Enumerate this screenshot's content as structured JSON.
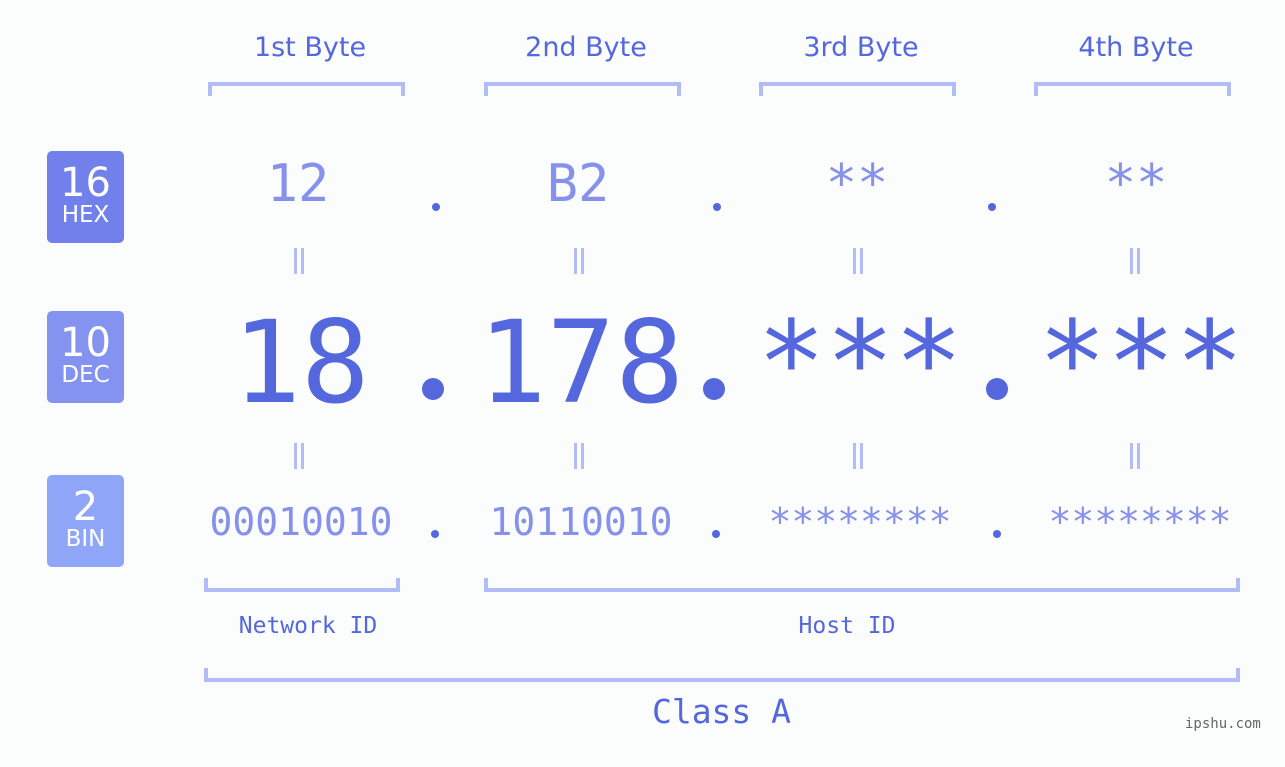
{
  "byte_headers": [
    "1st Byte",
    "2nd Byte",
    "3rd Byte",
    "4th Byte"
  ],
  "badges": {
    "hex": {
      "number": "16",
      "label": "HEX",
      "color": "#7180ea"
    },
    "dec": {
      "number": "10",
      "label": "DEC",
      "color": "#8593f0"
    },
    "bin": {
      "number": "2",
      "label": "BIN",
      "color": "#8fa6f8"
    }
  },
  "hex_values": [
    "12",
    "B2",
    "**",
    "**"
  ],
  "dec_values": [
    "18",
    "178",
    "***",
    "***"
  ],
  "bin_values": [
    "00010010",
    "10110010",
    "********",
    "********"
  ],
  "network_id_label": "Network ID",
  "host_id_label": "Host ID",
  "class_label": "Class A",
  "watermark": "ipshu.com",
  "colors": {
    "accent": "#5567dc",
    "light": "#8591ea",
    "bracket": "#b2bdf7"
  }
}
